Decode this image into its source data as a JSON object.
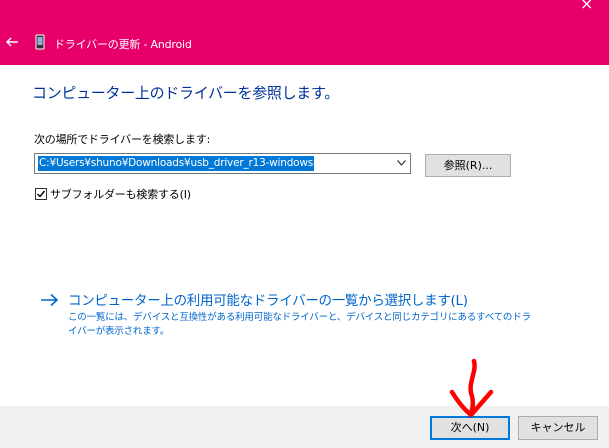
{
  "window": {
    "title": "ドライバーの更新 - Android",
    "back_icon": "back-arrow-icon",
    "device_icon": "phone-device-icon",
    "close_glyph": "×",
    "titlebar_color": "#e8006a"
  },
  "main": {
    "heading": "コンピューター上のドライバーを参照します。",
    "search_label": "次の場所でドライバーを検索します:",
    "path_value": "C:¥Users¥shuno¥Downloads¥usb_driver_r13-windows",
    "browse_label": "参照(R)...",
    "include_subfolders_label": "サブフォルダーも検索する(I)",
    "include_subfolders_checked": true,
    "pick_link": "コンピューター上の利用可能なドライバーの一覧から選択します(L)",
    "pick_description": "この一覧には、デバイスと互換性がある利用可能なドライバーと、デバイスと同じカテゴリにあるすべてのドライバーが表示されます。"
  },
  "footer": {
    "next_label": "次へ(N)",
    "cancel_label": "キャンセル"
  },
  "annotation": {
    "icon": "red-down-arrow-icon",
    "color": "#ff0000"
  }
}
